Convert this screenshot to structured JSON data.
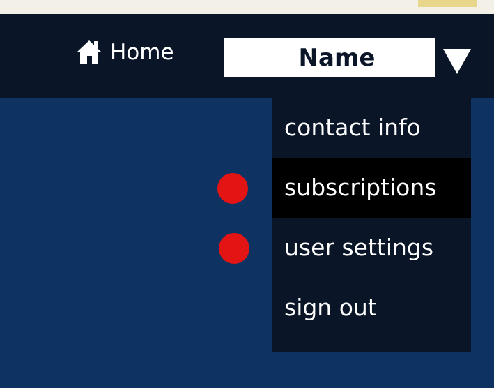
{
  "header": {
    "home_label": "Home",
    "home_icon": "home-icon",
    "user_name": "Name",
    "dropdown_icon": "triangle-down-icon"
  },
  "menu": {
    "items": [
      {
        "label": "contact info",
        "selected": false,
        "marked": false
      },
      {
        "label": "subscriptions",
        "selected": true,
        "marked": true
      },
      {
        "label": "user settings",
        "selected": false,
        "marked": true
      },
      {
        "label": "sign out",
        "selected": false,
        "marked": false
      }
    ]
  },
  "colors": {
    "page_background": "#0e3262",
    "header_background": "#0a1627",
    "menu_background": "#0a1627",
    "selected_item_background": "#000000",
    "marker_dot": "#e31414",
    "name_box": "#ffffff",
    "text": "#ffffff"
  }
}
